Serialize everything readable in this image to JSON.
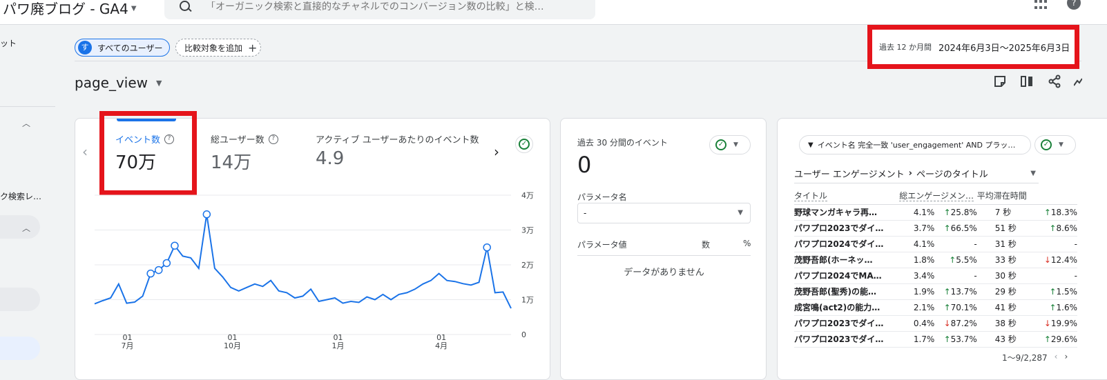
{
  "header": {
    "app_title": "パワ廃ブログ - GA4",
    "search_placeholder": "「オーガニック検索と直接的なチャネルでのコンバージョン数の比較」と検…"
  },
  "sidebar": {
    "items": [
      "ット",
      "ク検索レ…"
    ]
  },
  "filters": {
    "segment_avatar": "す",
    "segment_label": "すべてのユーザー",
    "add_compare_label": "比較対象を追加"
  },
  "date_range": {
    "period": "過去 12 か月間",
    "dates": "2024年6月3日～2025年6月3日"
  },
  "event_name": "page_view",
  "metrics": [
    {
      "label": "イベント数",
      "value": "70万"
    },
    {
      "label": "総ユーザー数",
      "value": "14万"
    },
    {
      "label": "アクティブ ユーザーあたりのイベント数",
      "value": "4.9"
    }
  ],
  "chart_data": {
    "type": "line",
    "x_tick_labels": [
      {
        "day": "01",
        "month": "7月"
      },
      {
        "day": "01",
        "month": "10月"
      },
      {
        "day": "01",
        "month": "1月"
      },
      {
        "day": "01",
        "month": "4月"
      }
    ],
    "y_tick_labels": [
      "4万",
      "3万",
      "2万",
      "1万",
      "0"
    ],
    "ylim": [
      0,
      40000
    ],
    "series": [
      {
        "values": [
          8800,
          9700,
          10500,
          14500,
          9000,
          9300,
          11000,
          17500,
          18500,
          20500,
          25500,
          22500,
          22000,
          19000,
          34500,
          19000,
          16500,
          13500,
          12500,
          13500,
          14500,
          13800,
          15500,
          12500,
          12000,
          10500,
          11000,
          13000,
          9500,
          10000,
          10500,
          9000,
          9500,
          9200,
          10800,
          10000,
          11500,
          10000,
          11500,
          12000,
          13000,
          14500,
          15500,
          17500,
          15500,
          15200,
          14600,
          14200,
          15000,
          25000,
          12000,
          12200,
          7500
        ],
        "highlighted_points": [
          7,
          8,
          9,
          10,
          14,
          49
        ]
      }
    ]
  },
  "realtime": {
    "label": "過去 30 分間のイベント",
    "value": "0",
    "param_name_label": "パラメータ名",
    "param_name_value": "-",
    "param_value_label": "パラメータ値",
    "count_label": "数",
    "percent_label": "%",
    "no_data": "データがありません"
  },
  "engagement": {
    "filter_label": "イベント名 完全一致 'user_engagement' AND プラッ…",
    "breadcrumb_root": "ユーザー エンゲージメント",
    "breadcrumb_child": "ページのタイトル",
    "columns": [
      "タイトル",
      "総エンゲージメン…",
      "平均滞在時間"
    ],
    "rows": [
      {
        "title": "野球マンガキャラ再…",
        "share": "4.1%",
        "change": "25.8%",
        "dir": "up",
        "time": "7 秒",
        "time_change": "18.3%",
        "time_dir": "up"
      },
      {
        "title": "パワプロ2023でダイ…",
        "share": "3.7%",
        "change": "66.5%",
        "dir": "up",
        "time": "51 秒",
        "time_change": "8.6%",
        "time_dir": "up"
      },
      {
        "title": "パワプロ2024でダイ…",
        "share": "4.1%",
        "change": "-",
        "dir": "none",
        "time": "31 秒",
        "time_change": "-",
        "time_dir": "none"
      },
      {
        "title": "茂野吾郎(ホーネッ…",
        "share": "1.8%",
        "change": "5.5%",
        "dir": "up",
        "time": "33 秒",
        "time_change": "12.4%",
        "time_dir": "down"
      },
      {
        "title": "パワプロ2024でMA…",
        "share": "3.4%",
        "change": "-",
        "dir": "none",
        "time": "30 秒",
        "time_change": "-",
        "time_dir": "none"
      },
      {
        "title": "茂野吾郎(聖秀)の能…",
        "share": "1.9%",
        "change": "13.7%",
        "dir": "up",
        "time": "29 秒",
        "time_change": "1.5%",
        "time_dir": "up"
      },
      {
        "title": "成宮鳴(act2)の能力…",
        "share": "2.1%",
        "change": "70.1%",
        "dir": "up",
        "time": "41 秒",
        "time_change": "1.6%",
        "time_dir": "up"
      },
      {
        "title": "パワプロ2023でダイ…",
        "share": "0.4%",
        "change": "87.2%",
        "dir": "down",
        "time": "38 秒",
        "time_change": "19.9%",
        "time_dir": "down"
      },
      {
        "title": "パワプロ2023でダイ…",
        "share": "1.7%",
        "change": "53.7%",
        "dir": "up",
        "time": "43 秒",
        "time_change": "29.6%",
        "time_dir": "up"
      }
    ],
    "pager": "1～9/2,287"
  },
  "colors": {
    "accent": "#1a73e8",
    "highlight_red": "#e5141b",
    "positive": "#188038",
    "negative": "#d93025"
  }
}
